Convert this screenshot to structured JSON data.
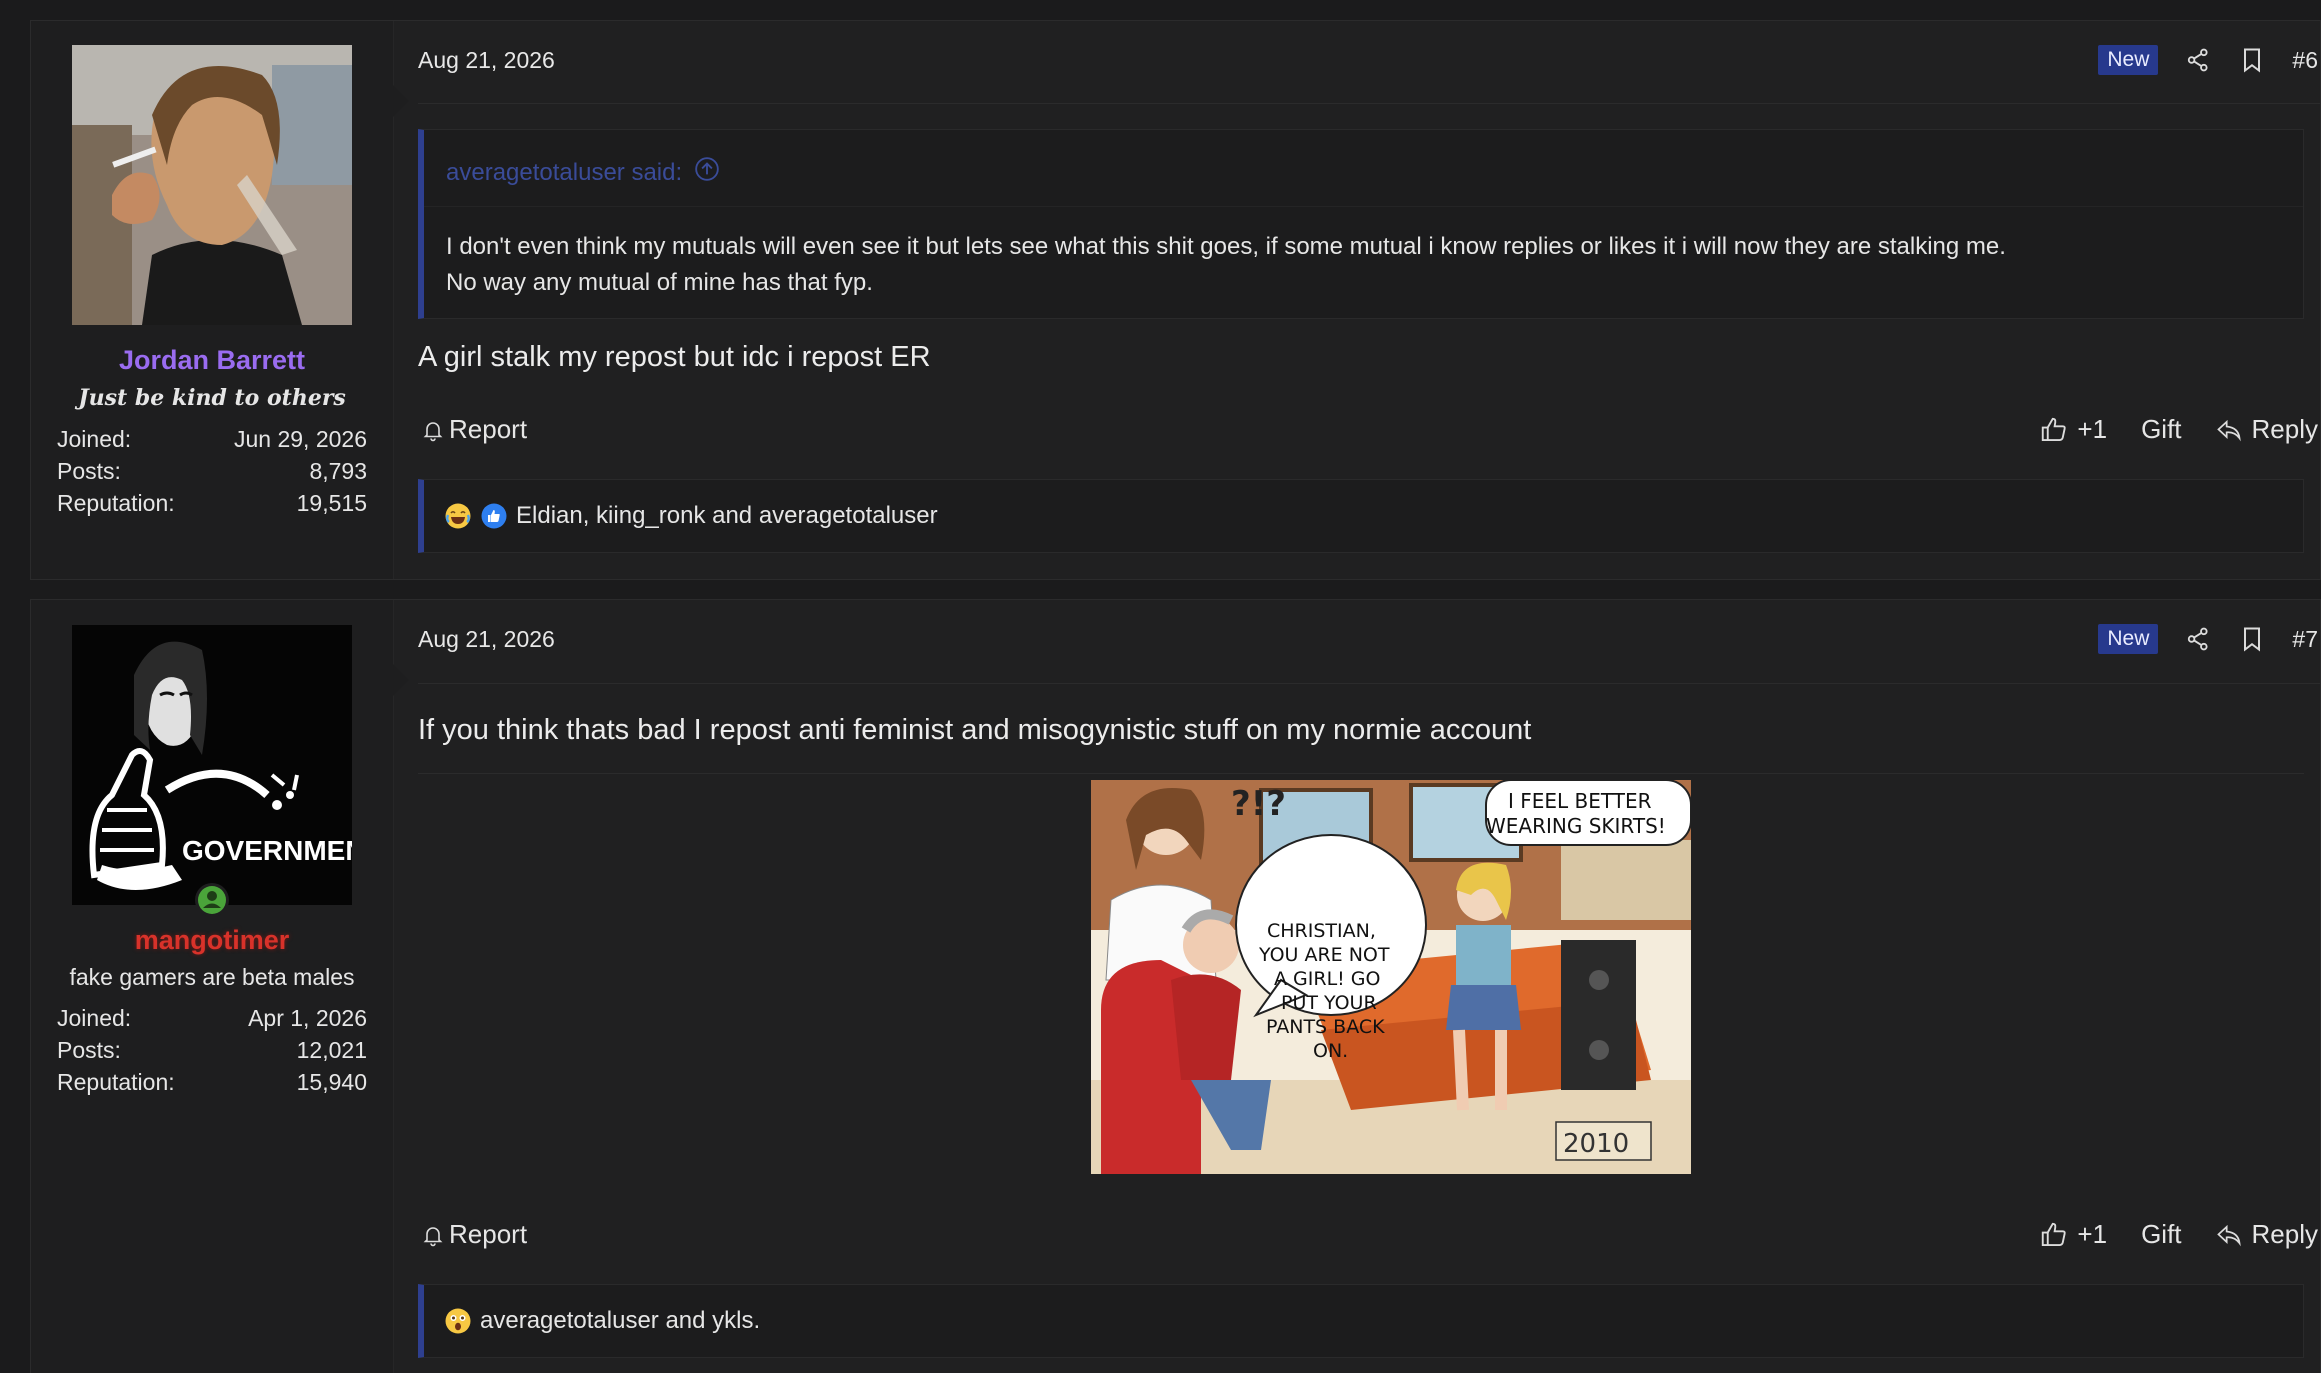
{
  "posts": [
    {
      "user": {
        "name": "Jordan Barrett",
        "title": "Just be kind to others",
        "joined_label": "Joined:",
        "joined": "Jun 29, 2026",
        "posts_label": "Posts:",
        "posts": "8,793",
        "reputation_label": "Reputation:",
        "reputation": "19,515",
        "name_color": "#9a6cf0"
      },
      "date": "Aug 21, 2026",
      "badge": "New",
      "number": "#6",
      "quote": {
        "author": "averagetotaluser said:",
        "lines": [
          "I don't even think my mutuals will even see it but lets see what this shit goes, if some mutual i know replies or likes it i will now they are stalking me.",
          "No way any mutual of mine has that fyp."
        ]
      },
      "text": "A girl stalk my repost but idc i repost ER",
      "actions": {
        "report": "Report",
        "like": "+1",
        "gift": "Gift",
        "reply": "Reply"
      },
      "reactions": "Eldian, kiing_ronk and averagetotaluser"
    },
    {
      "user": {
        "name": "mangotimer",
        "title": "fake gamers are beta males",
        "joined_label": "Joined:",
        "joined": "Apr 1, 2026",
        "posts_label": "Posts:",
        "posts": "12,021",
        "reputation_label": "Reputation:",
        "reputation": "15,940",
        "name_color": "#d8322a",
        "avatar_caption": "GOVERNMENT"
      },
      "date": "Aug 21, 2026",
      "badge": "New",
      "number": "#7",
      "text": "If you think thats bad I repost anti feminist and misogynistic stuff on my normie account",
      "comic": {
        "bubble_top": "?!?",
        "bubble_right": [
          "I FEEL BETTER",
          "WEARING SKIRTS!"
        ],
        "bubble_left": [
          "CHRISTIAN,",
          "YOU ARE NOT",
          "A GIRL!  GO",
          "PUT YOUR",
          "PANTS BACK",
          "ON."
        ],
        "year": "2010"
      },
      "actions": {
        "report": "Report",
        "like": "+1",
        "gift": "Gift",
        "reply": "Reply"
      },
      "reactions": "averagetotaluser and ykls."
    }
  ],
  "icons": {
    "share": "share-icon",
    "bookmark": "bookmark-icon",
    "bell": "bell-icon",
    "like": "thumbs-up-icon",
    "reply": "reply-icon",
    "quote_up": "arrow-up-circle-icon",
    "online": "online-status-icon"
  }
}
